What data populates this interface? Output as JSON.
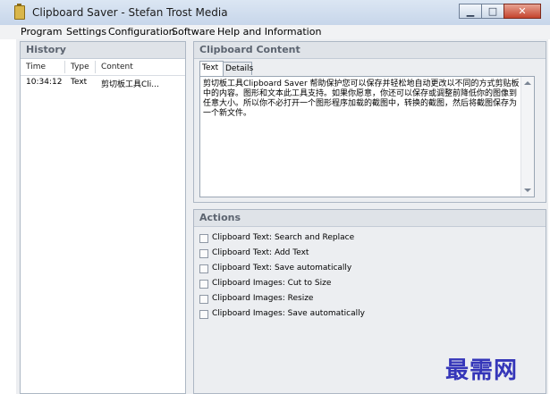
{
  "window": {
    "title": "Clipboard Saver - Stefan Trost Media",
    "controls": [
      "minimize-icon",
      "maximize-icon",
      "close-icon"
    ]
  },
  "menu": [
    "Program",
    "Settings",
    "Configuration",
    "Software",
    "Help and Information"
  ],
  "history": {
    "title": "History",
    "columns": [
      "Time",
      "Type",
      "Content"
    ],
    "rows": [
      {
        "time": "10:34:12",
        "type": "Text",
        "content": "剪切板工具Cli..."
      }
    ]
  },
  "clipboard_content": {
    "title": "Clipboard Content",
    "tabs": [
      "Text",
      "Details"
    ],
    "active_tab": "Text",
    "text": "剪切板工具Clipboard Saver 帮助保护您可以保存并轻松地自动更改以不同的方式剪贴板中的内容。图形和文本此工具支持。如果你愿意，你还可以保存或调整前降低你的图像到任意大小。所以你不必打开一个图形程序加载的截图中，转换的截图，然后将截图保存为一个新文件。"
  },
  "actions": {
    "title": "Actions",
    "items": [
      {
        "label": "Clipboard Text: Search and Replace",
        "checked": false
      },
      {
        "label": "Clipboard Text: Add Text",
        "checked": false
      },
      {
        "label": "Clipboard Text: Save automatically",
        "checked": false
      },
      {
        "label": "Clipboard Images: Cut to Size",
        "checked": false
      },
      {
        "label": "Clipboard Images: Resize",
        "checked": false
      },
      {
        "label": "Clipboard Images: Save automatically",
        "checked": false
      }
    ]
  },
  "watermark": "最需网"
}
